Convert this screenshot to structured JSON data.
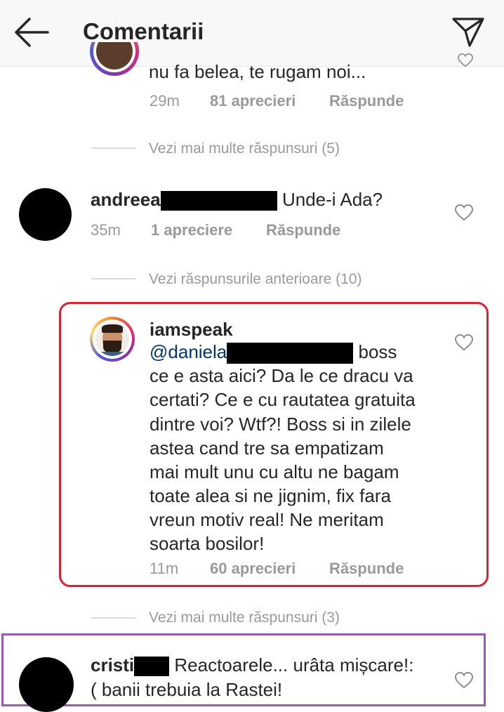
{
  "header": {
    "title": "Comentarii"
  },
  "top_reply": {
    "text": "nu fa belea, te rugam noi...",
    "time": "29m",
    "likes": "81 aprecieri",
    "reply": "Răspunde"
  },
  "more_replies_1": "Vezi mai multe răspunsuri (5)",
  "comment_andreea": {
    "user": "andreea",
    "text": "Unde-i Ada?",
    "time": "35m",
    "likes": "1 apreciere",
    "reply": "Răspunde"
  },
  "previous_replies": "Vezi răspunsurile anterioare (10)",
  "reply_iamspeak": {
    "user": "iamspeak",
    "mention": "@daniela",
    "lines": [
      "boss",
      "ce e asta aici? Da le ce dracu va",
      "certati? Ce e cu rautatea gratuita",
      "dintre voi? Wtf?! Boss si in zilele",
      "astea cand tre sa empatizam",
      "mai mult unu cu altu ne bagam",
      "toate alea si ne jignim, fix fara",
      "vreun motiv real! Ne meritam",
      "soarta bosilor!"
    ],
    "time": "11m",
    "likes": "60 aprecieri",
    "reply": "Răspunde"
  },
  "more_replies_2": "Vezi mai multe răspunsuri (3)",
  "comment_cristi": {
    "user": "cristi",
    "line1": "Reactoarele... urâta mișcare!:",
    "line2": "( banii trebuia la Rastei!"
  },
  "colors": {
    "highlight_red": "#e0202e",
    "highlight_purple": "#9b59b6",
    "mention": "#00376b"
  },
  "icons": [
    "back-arrow-icon",
    "send-icon",
    "heart-icon"
  ]
}
